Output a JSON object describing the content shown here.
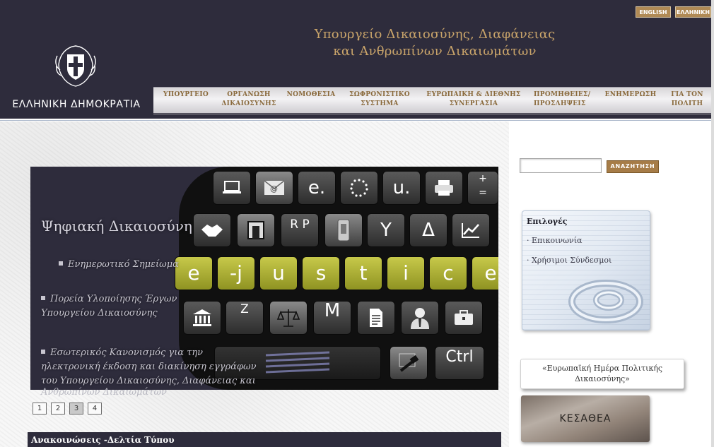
{
  "header": {
    "lang_english": "ENGLISH",
    "lang_greek": "ΕΛΛΗΝΙΚΗ",
    "ministry_line1": "Υπουργείο Δικαιοσύνης, Διαφάνειας",
    "ministry_line2": "και Ανθρωπίνων Δικαιωμάτων",
    "republic": "ΕΛΛΗΝΙΚΗ ΔΗΜΟΚΡΑΤΙΑ",
    "emblem_icon": "greek-coat-of-arms-icon"
  },
  "nav": {
    "items": [
      {
        "label": "ΥΠΟΥΡΓΕΙΟ"
      },
      {
        "label": "ΟΡΓΑΝΩΣΗ\nΔΙΚΑΙΟΣΥΝΗΣ"
      },
      {
        "label": "ΝΟΜΟΘΕΣΙΑ"
      },
      {
        "label": "ΣΩΦΡΟΝΙΣΤΙΚΟ\nΣΥΣΤΗΜΑ"
      },
      {
        "label": "ΕΥΡΩΠΑΙΚΗ & ΔΙΕΘΝΗΣ\nΣΥΝΕΡΓΑΣΙΑ"
      },
      {
        "label": "ΠΡΟΜΗΘΕΙΕΣ/\nΠΡΟΣΛΗΨΕΙΣ"
      },
      {
        "label": "ΕΝΗΜΕΡΩΣΗ"
      },
      {
        "label": "ΓΙΑ ΤΟΝ\nΠΟΛΙΤΗ"
      }
    ]
  },
  "slider": {
    "title": "Ψηφιακή Δικαιοσύνη",
    "links": [
      "Ενημερωτικό Σημείωμα",
      "Πορεία Υλοποίησης Έργων Υπουργείου Δικαιοσύνης",
      "Εσωτερικός Κανονισμός για την ηλεκτρονική έκδοση και διακίνηση εγγράφων του Υπουργείου Δικαιοσύνης, Διαφάνειας και",
      "Ανθρωπίνων Δικαιωμάτων"
    ],
    "keys": {
      "row1": [
        "",
        "e.",
        "",
        "u.",
        ""
      ],
      "row2": [
        "",
        "",
        "R P",
        "",
        "Y",
        "Δ",
        ""
      ],
      "row3": [
        "e",
        "-j",
        "u",
        "s",
        "t",
        "i",
        "c",
        "e"
      ],
      "row4": [
        "",
        "Z",
        "",
        "M",
        "",
        "",
        ""
      ],
      "row5": [
        "",
        "Ctrl"
      ]
    },
    "pages": [
      "1",
      "2",
      "3",
      "4"
    ],
    "active_page": "3"
  },
  "news": {
    "label": "Ανακοινώσεις -Δελτία Τύπου"
  },
  "search": {
    "placeholder": "",
    "button_label": "ΑΝΑΖΗΤΗΣΗ"
  },
  "options": {
    "title": "Επιλογές",
    "links": [
      "· Επικοινωνία",
      "· Χρήσιμοι Σύνδεσμοι"
    ],
    "icon": "at-sign-icon"
  },
  "banners": {
    "justice_day": "«Ευρωπαϊκή Ημέρα Πολιτικής Δικαιοσύνης»",
    "kesathea": "ΚΕΣΑΘΕΑ"
  },
  "colors": {
    "header_bg": "#2e2c3c",
    "title_gold": "#c9a46a",
    "accent_button": "#a67c47",
    "key_yellow": "#b5b83a"
  }
}
